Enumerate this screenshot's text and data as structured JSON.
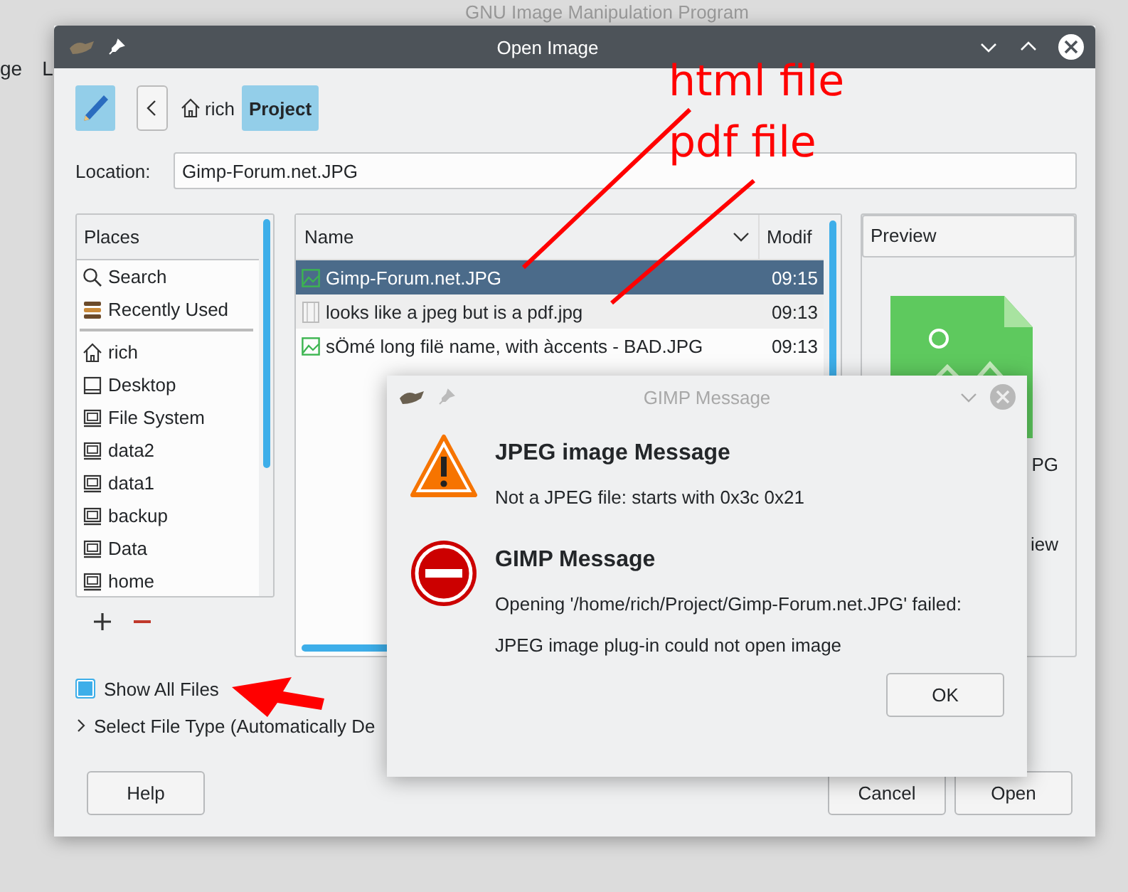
{
  "background_window": {
    "title": "GNU Image Manipulation Program",
    "menu": [
      "ge",
      "L"
    ]
  },
  "dialog": {
    "title": "Open Image"
  },
  "path_bar": {
    "items": [
      {
        "label": "rich",
        "kind": "home",
        "selected": false
      },
      {
        "label": "Project",
        "kind": "folder",
        "selected": true
      }
    ]
  },
  "location": {
    "label": "Location:",
    "value": "Gimp-Forum.net.JPG"
  },
  "places": {
    "header": "Places",
    "items": [
      {
        "label": "Search",
        "kind": "search"
      },
      {
        "label": "Recently Used",
        "kind": "recent"
      },
      {
        "kind": "separator"
      },
      {
        "label": "rich",
        "kind": "home"
      },
      {
        "label": "Desktop",
        "kind": "desktop"
      },
      {
        "label": "File System",
        "kind": "drive"
      },
      {
        "label": "data2",
        "kind": "drive"
      },
      {
        "label": "data1",
        "kind": "drive"
      },
      {
        "label": "backup",
        "kind": "drive"
      },
      {
        "label": "Data",
        "kind": "drive"
      },
      {
        "label": "home",
        "kind": "drive"
      }
    ]
  },
  "files": {
    "columns": [
      "Name",
      "Modif"
    ],
    "rows": [
      {
        "name": "Gimp-Forum.net.JPG",
        "time": "09:15",
        "kind": "image",
        "selected": true
      },
      {
        "name": "looks like a jpeg but is a pdf.jpg",
        "time": "09:13",
        "kind": "document",
        "selected": false
      },
      {
        "name": "sÖmé  long filë name, with àccents - BAD.JPG",
        "time": "09:13",
        "kind": "image",
        "selected": false
      }
    ]
  },
  "preview": {
    "header": "Preview",
    "fragments": [
      "PG",
      "iew"
    ]
  },
  "show_all_files": {
    "label": "Show All Files",
    "checked": true
  },
  "file_type": {
    "label": "Select File Type (Automatically De",
    "expanded": false
  },
  "buttons": [
    {
      "label": "Help"
    },
    {
      "label": "Cancel"
    },
    {
      "label": "Open"
    }
  ],
  "message": {
    "title": "GIMP Message",
    "entries": [
      {
        "kind": "warning",
        "heading": "JPEG image Message",
        "lines": [
          "Not a JPEG file: starts with 0x3c 0x21"
        ]
      },
      {
        "kind": "error",
        "heading": "GIMP Message",
        "lines": [
          "Opening '/home/rich/Project/Gimp-Forum.net.JPG' failed:",
          "JPEG image plug-in could not open image"
        ]
      }
    ],
    "button": "OK"
  },
  "annotations": [
    {
      "text": "html file"
    },
    {
      "text": "pdf file"
    }
  ]
}
